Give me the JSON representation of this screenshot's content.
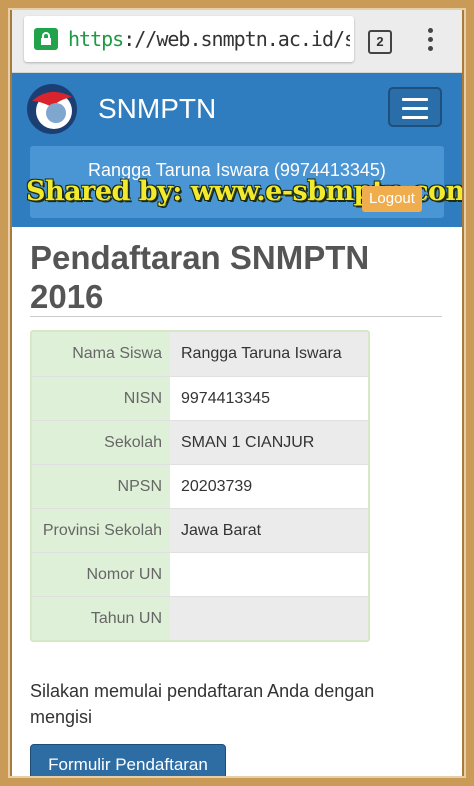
{
  "browser": {
    "url_scheme": "https",
    "url_rest": "://web.snmptn.ac.id/s",
    "tab_count": "2",
    "icons": {
      "lock": "lock-icon",
      "menu": "more-vert-icon"
    }
  },
  "header": {
    "site_name": "SNMPTN",
    "user_name": "Rangga Taruna Iswara (9974413345)",
    "logout_label": "Logout",
    "watermark": "Shared by: www.e-sbmptn.com",
    "colors": {
      "header_bg": "#2f7cbf",
      "panel_bg": "#4a95d4",
      "logout_bg": "#f0ad4e"
    }
  },
  "main": {
    "title": "Pendaftaran SNMPTN 2016",
    "rows": [
      {
        "label": "Nama Siswa",
        "value": "Rangga Taruna Iswara"
      },
      {
        "label": "NISN",
        "value": "9974413345"
      },
      {
        "label": "Sekolah",
        "value": "SMAN 1 CIANJUR"
      },
      {
        "label": "NPSN",
        "value": "20203739"
      },
      {
        "label": "Provinsi Sekolah",
        "value": "Jawa Barat"
      },
      {
        "label": "Nomor UN",
        "value": ""
      },
      {
        "label": "Tahun UN",
        "value": ""
      }
    ],
    "intro": "Silakan memulai pendaftaran Anda dengan mengisi",
    "form_button": "Formulir Pendaftaran",
    "colors": {
      "label_bg": "#dff0d8",
      "button_bg": "#2e6da4"
    }
  }
}
